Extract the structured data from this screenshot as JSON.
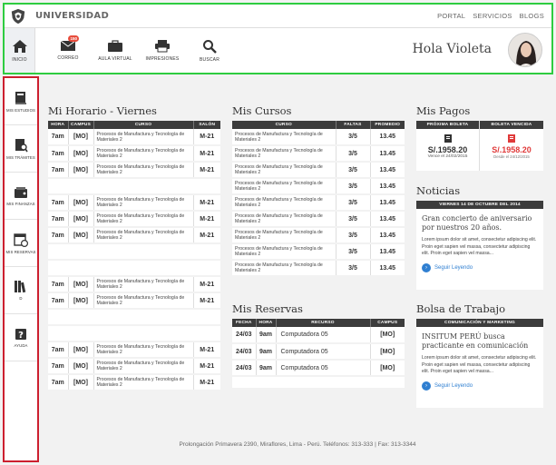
{
  "brand": {
    "name": "UNIVERSIDAD"
  },
  "toplinks": [
    "PORTAL",
    "SERVICIOS",
    "BLOGS"
  ],
  "nav": {
    "items": [
      {
        "label": "INICIO",
        "icon": "home-icon"
      },
      {
        "label": "CORREO",
        "icon": "mail-icon",
        "badge": "150"
      },
      {
        "label": "AULA VIRTUAL",
        "icon": "briefcase-icon"
      },
      {
        "label": "IMPRESIONES",
        "icon": "printer-icon"
      },
      {
        "label": "BUSCAR",
        "icon": "search-icon"
      }
    ]
  },
  "greeting": "Hola Violeta",
  "sidebar": {
    "items": [
      {
        "label": "MIS ESTUDIOS",
        "icon": "book-icon"
      },
      {
        "label": "MIS TRÁMITES",
        "icon": "document-search-icon"
      },
      {
        "label": "MIS FINANZAS",
        "icon": "wallet-icon"
      },
      {
        "label": "MIS RESERVAS",
        "icon": "calendar-icon"
      },
      {
        "label": "D",
        "icon": "library-icon"
      },
      {
        "label": "AYUDA",
        "icon": "help-icon"
      }
    ]
  },
  "horario": {
    "title": "Mi Horario - Viernes",
    "headers": [
      "HORA",
      "CAMPUS",
      "CURSO",
      "SALÓN"
    ],
    "rows": [
      {
        "hora": "7am",
        "campus": "[MO]",
        "curso": "Procesos de Manufactura y Tecnología de Materiales 2",
        "salon": "M-21"
      },
      {
        "hora": "7am",
        "campus": "[MO]",
        "curso": "Procesos de Manufactura y Tecnología de Materiales 2",
        "salon": "M-21"
      },
      {
        "hora": "7am",
        "campus": "[MO]",
        "curso": "Procesos de Manufactura y Tecnología de Materiales 2",
        "salon": "M-21"
      },
      null,
      {
        "hora": "7am",
        "campus": "[MO]",
        "curso": "Procesos de Manufactura y Tecnología de Materiales 2",
        "salon": "M-21"
      },
      {
        "hora": "7am",
        "campus": "[MO]",
        "curso": "Procesos de Manufactura y Tecnología de Materiales 2",
        "salon": "M-21"
      },
      {
        "hora": "7am",
        "campus": "[MO]",
        "curso": "Procesos de Manufactura y Tecnología de Materiales 2",
        "salon": "M-21"
      },
      null,
      null,
      {
        "hora": "7am",
        "campus": "[MO]",
        "curso": "Procesos de Manufactura y Tecnología de Materiales 2",
        "salon": "M-21"
      },
      {
        "hora": "7am",
        "campus": "[MO]",
        "curso": "Procesos de Manufactura y Tecnología de Materiales 2",
        "salon": "M-21"
      },
      null,
      null,
      {
        "hora": "7am",
        "campus": "[MO]",
        "curso": "Procesos de Manufactura y Tecnología de Materiales 2",
        "salon": "M-21"
      },
      {
        "hora": "7am",
        "campus": "[MO]",
        "curso": "Procesos de Manufactura y Tecnología de Materiales 2",
        "salon": "M-21"
      },
      {
        "hora": "7am",
        "campus": "[MO]",
        "curso": "Procesos de Manufactura y Tecnología de Materiales 2",
        "salon": "M-21"
      }
    ]
  },
  "cursos": {
    "title": "Mis Cursos",
    "headers": [
      "CURSO",
      "FALTAS",
      "PROMEDIO"
    ],
    "rows": [
      {
        "curso": "Procesos de Manufactura y Tecnología de Materiales 2",
        "faltas": "3/5",
        "promedio": "13.45"
      },
      {
        "curso": "Procesos de Manufactura y Tecnología de Materiales 2",
        "faltas": "3/5",
        "promedio": "13.45"
      },
      {
        "curso": "Procesos de Manufactura y Tecnología de Materiales 2",
        "faltas": "3/5",
        "promedio": "13.45"
      },
      {
        "curso": "Procesos de Manufactura y Tecnología de Materiales 2",
        "faltas": "3/5",
        "promedio": "13.45"
      },
      {
        "curso": "Procesos de Manufactura y Tecnología de Materiales 2",
        "faltas": "3/5",
        "promedio": "13.45"
      },
      {
        "curso": "Procesos de Manufactura y Tecnología de Materiales 2",
        "faltas": "3/5",
        "promedio": "13.45"
      },
      {
        "curso": "Procesos de Manufactura y Tecnología de Materiales 2",
        "faltas": "3/5",
        "promedio": "13.45"
      },
      {
        "curso": "Procesos de Manufactura y Tecnología de Materiales 2",
        "faltas": "3/5",
        "promedio": "13.45"
      },
      {
        "curso": "Procesos de Manufactura y Tecnología de Materiales 2",
        "faltas": "3/5",
        "promedio": "13.45"
      }
    ]
  },
  "reservas": {
    "title": "Mis Reservas",
    "headers": [
      "FECHA",
      "HORA",
      "RECURSO",
      "CAMPUS"
    ],
    "rows": [
      {
        "fecha": "24/03",
        "hora": "9am",
        "recurso": "Computadora 05",
        "campus": "[MO]"
      },
      {
        "fecha": "24/03",
        "hora": "9am",
        "recurso": "Computadora 05",
        "campus": "[MO]"
      },
      {
        "fecha": "24/03",
        "hora": "9am",
        "recurso": "Computadora 05",
        "campus": "[MO]"
      }
    ]
  },
  "pagos": {
    "title": "Mis Pagos",
    "proxima": {
      "header": "PRÓXIMA BOLETA",
      "amount": "S/.1958.20",
      "note": "Vence el 24/02/2015"
    },
    "vencida": {
      "header": "BOLETA VENCIDA",
      "amount": "S/.1958.20",
      "note": "Desde el 24/12/2015"
    },
    "colors": {
      "vencida": "#e03a3a"
    }
  },
  "noticias": {
    "title": "Noticias",
    "date": "VIERNES 14 DE OCTUBRE DEL 2014",
    "headline": "Gran concierto de aniversario por nuestros 20 años.",
    "body": "Lorem ipsum dolor sit amet, consectetur adipiscing elit. Proin eget sapien vel massa, consectetur adipiscing elit. Proin eget sapien vel massa...",
    "more": "Seguir Leyendo"
  },
  "bolsa": {
    "title": "Bolsa de Trabajo",
    "category": "COMUNICACIÓN Y MARKETING",
    "headline": "INSITUM PERÚ busca practicante en comunicación",
    "body": "Lorem ipsum dolor sit amet, consectetur adipiscing elit. Proin eget sapien vel massa, consectetur adipiscing elit. Proin eget sapien vel massa...",
    "more": "Seguir Leyendo"
  },
  "footer": "Prolongación Primavera 2390, Miraflores, Lima - Perú. Teléfonos: 313-333 | Fax: 313-3344"
}
